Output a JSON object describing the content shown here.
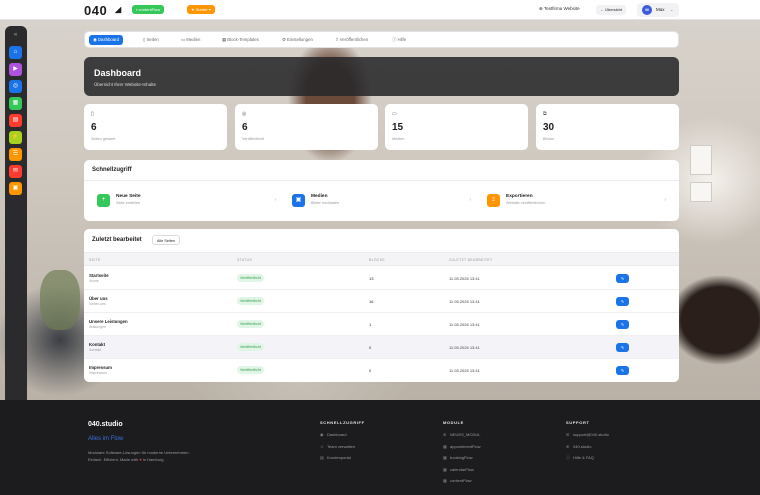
{
  "topbar": {
    "logo": "040",
    "app_pill": "contentFlow",
    "plan_pill": "Starter",
    "site_link": "Testfirma Website",
    "overview_btn": "Übersicht",
    "user_initial": "M",
    "user_name": "Max"
  },
  "tabs": [
    {
      "label": "Dashboard",
      "icon": "dashboard-icon"
    },
    {
      "label": "Seiten",
      "icon": "page-icon"
    },
    {
      "label": "Medien",
      "icon": "image-icon"
    },
    {
      "label": "Block-Templates",
      "icon": "template-icon"
    },
    {
      "label": "Einstellungen",
      "icon": "gear-icon"
    },
    {
      "label": "Veröffentlichen",
      "icon": "publish-icon"
    },
    {
      "label": "Hilfe",
      "icon": "help-icon"
    }
  ],
  "hero": {
    "title": "Dashboard",
    "subtitle": "Übersicht Ihrer Website-Inhalte"
  },
  "stats": [
    {
      "value": "6",
      "label": "Seiten gesamt",
      "icon": "page-icon"
    },
    {
      "value": "6",
      "label": "Veröffentlicht",
      "icon": "check-circle-icon"
    },
    {
      "value": "15",
      "label": "Medien",
      "icon": "image-icon"
    },
    {
      "value": "30",
      "label": "Blöcke",
      "icon": "blocks-icon"
    }
  ],
  "quick": {
    "title": "Schnellzugriff",
    "items": [
      {
        "title": "Neue Seite",
        "sub": "Seite erstellen",
        "icon": "plus-icon",
        "color": "#34c759"
      },
      {
        "title": "Medien",
        "sub": "Bilder hochladen",
        "icon": "image-icon",
        "color": "#1a73e8"
      },
      {
        "title": "Exportieren",
        "sub": "Website veröffentlichen",
        "icon": "export-icon",
        "color": "#ff9500"
      }
    ]
  },
  "recent": {
    "title": "Zuletzt bearbeitet",
    "all_btn": "Alle Seiten",
    "headers": [
      "SEITE",
      "STATUS",
      "BLÖCKE",
      "ZULETZT BEARBEITET"
    ],
    "rows": [
      {
        "name": "Startseite",
        "slug": "/home",
        "status": "Veröffentlicht",
        "blocks": "13",
        "date": "11.05.2026 13:41"
      },
      {
        "name": "Über uns",
        "slug": "/ueber-uns",
        "status": "Veröffentlicht",
        "blocks": "16",
        "date": "11.05.2026 13:41"
      },
      {
        "name": "Unsere Leistungen",
        "slug": "/leistungen",
        "status": "Veröffentlicht",
        "blocks": "1",
        "date": "11.05.2026 13:41"
      },
      {
        "name": "Kontakt",
        "slug": "/kontakt",
        "status": "Veröffentlicht",
        "blocks": "0",
        "date": "11.05.2026 13:41"
      },
      {
        "name": "Impressum",
        "slug": "/impressum",
        "status": "Veröffentlicht",
        "blocks": "0",
        "date": "11.05.2026 13:41"
      }
    ]
  },
  "footer": {
    "brand": "040.studio",
    "tagline": "Alles im Flow",
    "desc1": "Modulare Software-Lösungen für moderne Unternehmen.",
    "desc2_pre": "Einfach. Effizient. Made with",
    "desc2_heart": "♥",
    "desc2_post": "in Hamburg.",
    "cols": [
      {
        "title": "SCHNELLZUGRIFF",
        "items": [
          "Dashboard",
          "Team verwalten",
          "Kundenportal"
        ]
      },
      {
        "title": "MODULE",
        "items": [
          "NEUES_MODUL",
          "appointmentFlow",
          "bookingFlow",
          "calendarFlow",
          "contentFlow"
        ]
      },
      {
        "title": "SUPPORT",
        "items": [
          "support@040.studio",
          "040.studio",
          "Hilfe & FAQ"
        ]
      }
    ]
  },
  "dock_colors": [
    "#1a73e8",
    "#af52de",
    "#1a73e8",
    "#34c759",
    "#ff3b30",
    "#a8d21f",
    "#ff9500",
    "#ff3b30",
    "#ff9500"
  ],
  "colors": {
    "accent": "#1a73e8",
    "dark": "#1c1c1e",
    "success": "#34c759"
  }
}
